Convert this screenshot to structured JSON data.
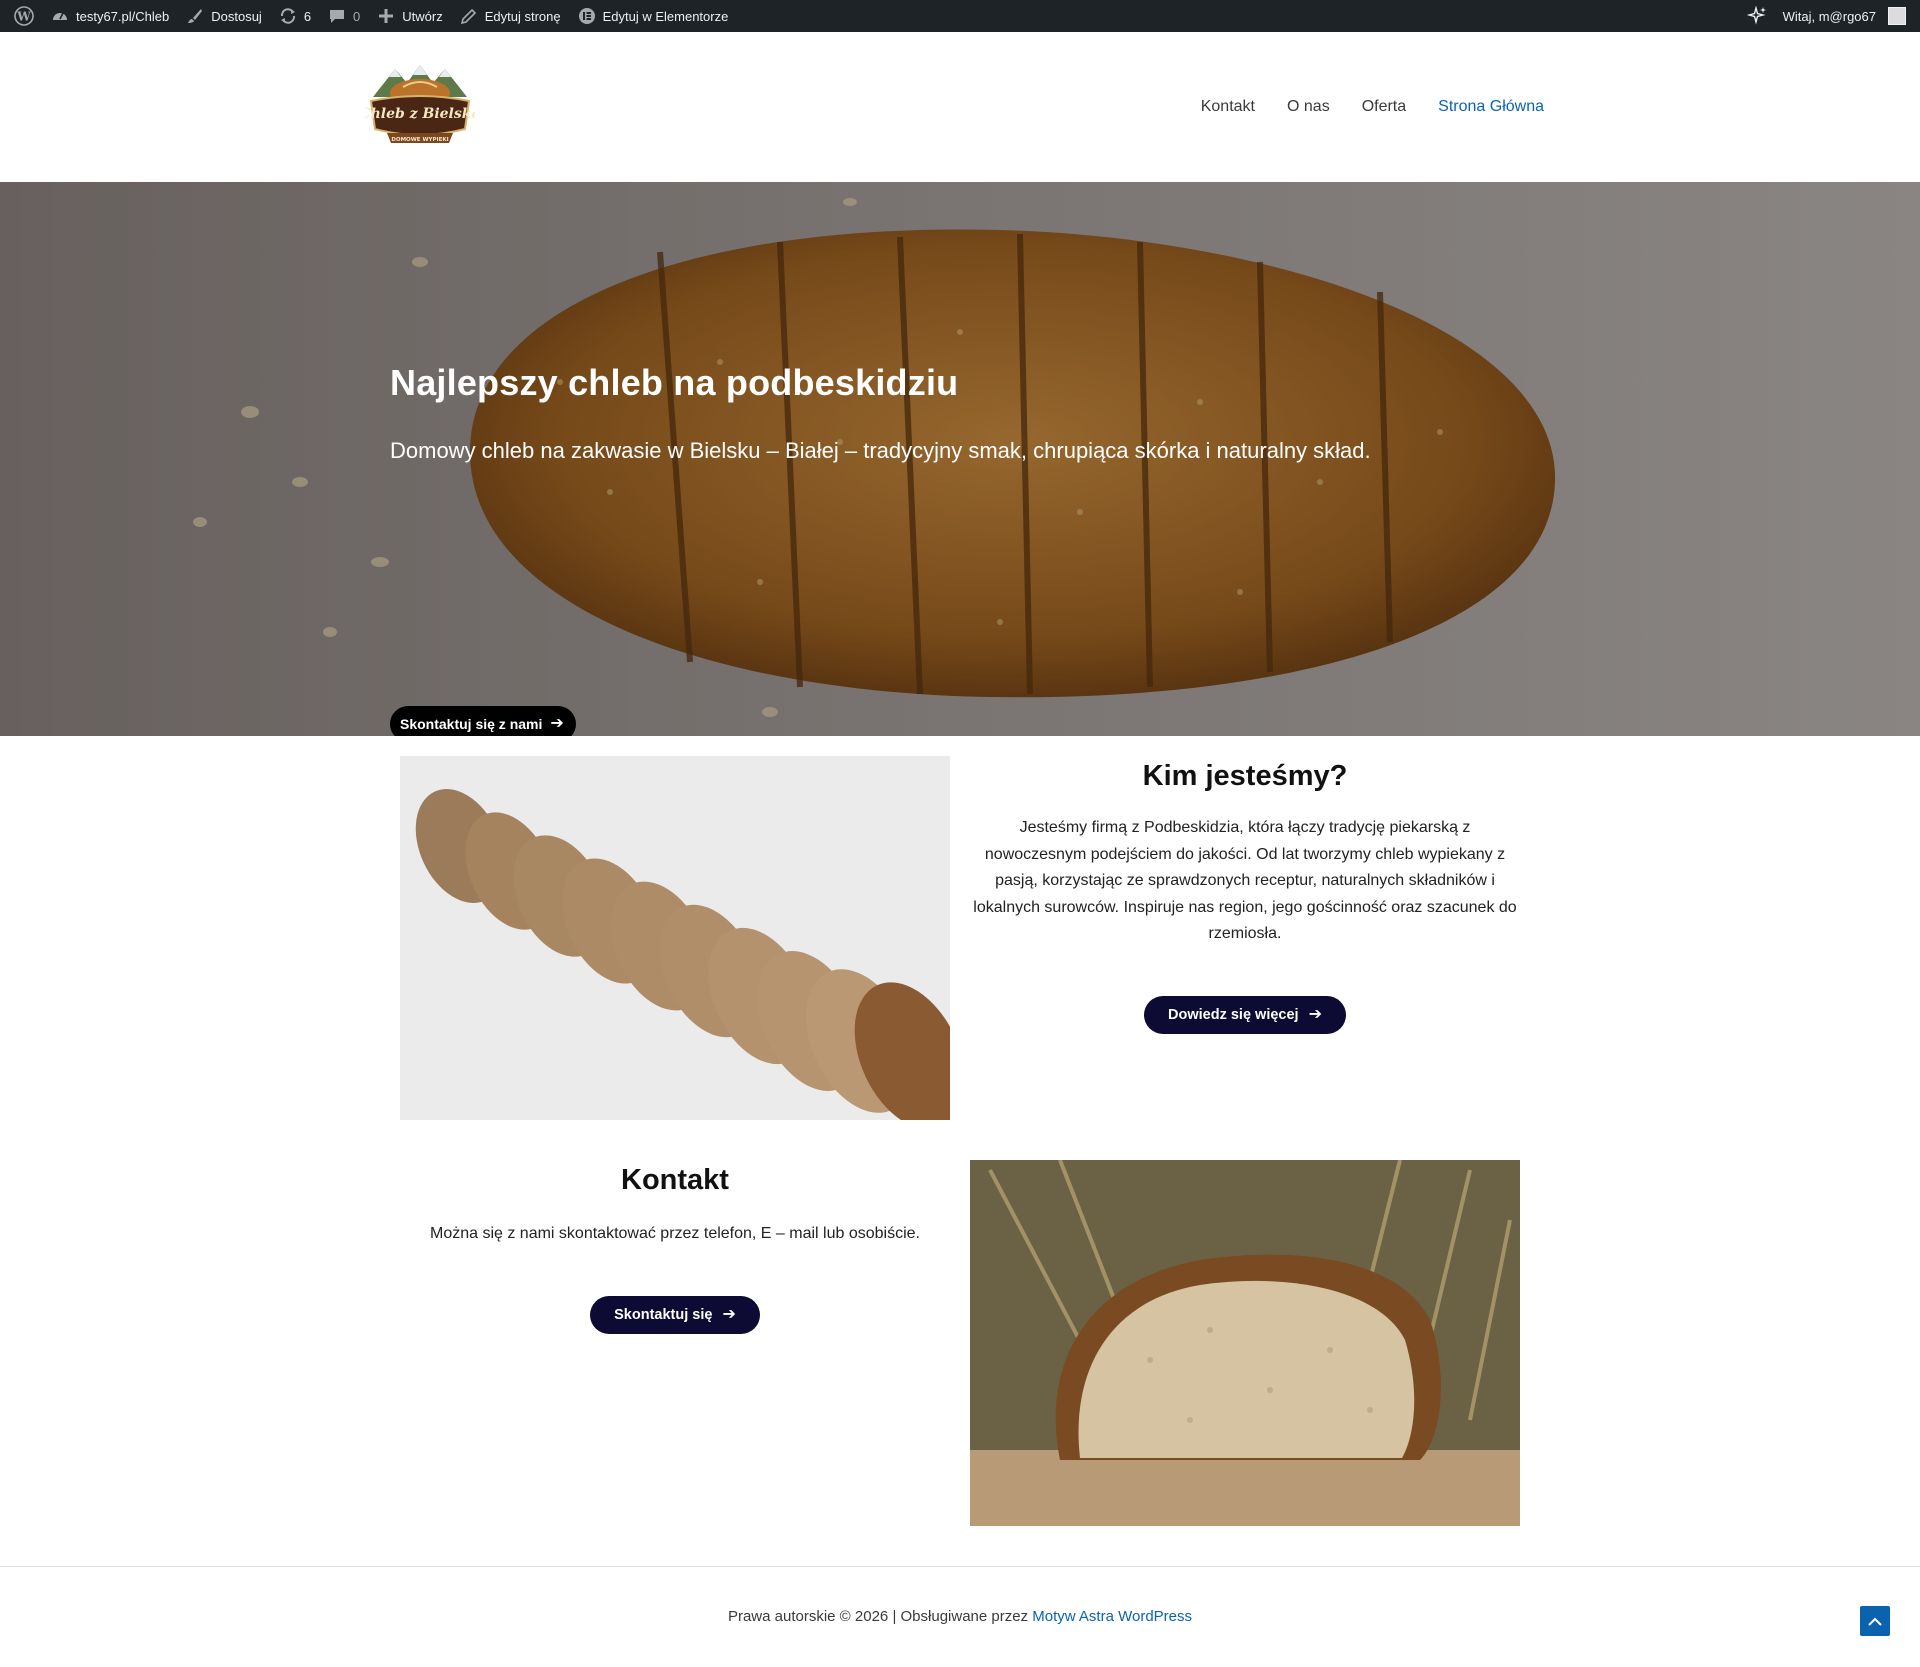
{
  "admin_bar": {
    "site_name": "testy67.pl/Chleb",
    "customize": "Dostosuj",
    "updates_count": "6",
    "comments_count": "0",
    "create": "Utwórz",
    "edit_page": "Edytuj stronę",
    "edit_elementor": "Edytuj w Elementorze",
    "greeting": "Witaj, m@rgo67"
  },
  "header": {
    "logo_text": "Chleb z Bielska",
    "logo_subtext": "DOMOWE WYPIEKI",
    "nav": [
      {
        "label": "Kontakt",
        "active": false
      },
      {
        "label": "O nas",
        "active": false
      },
      {
        "label": "Oferta",
        "active": false
      },
      {
        "label": "Strona Główna",
        "active": true
      }
    ]
  },
  "hero": {
    "title": "Najlepszy chleb na podbeskidziu",
    "subtitle": "Domowy chleb na zakwasie w Bielsku – Białej – tradycyjny smak, chrupiąca skórka i naturalny skład.",
    "button": "Skontaktuj się z nami"
  },
  "about": {
    "title": "Kim jesteśmy?",
    "text": "Jesteśmy firmą z Podbeskidzia, która łączy tradycję piekarską z nowoczesnym podejściem do jakości. Od lat tworzymy chleb wypiekany z pasją, korzystając ze sprawdzonych receptur, naturalnych składników i lokalnych surowców. Inspiruje nas region, jego gościnność oraz szacunek do rzemiosła.",
    "button": "Dowiedz się więcej"
  },
  "contact": {
    "title": "Kontakt",
    "text": "Można się z nami skontaktować przez telefon, E – mail lub osobiście.",
    "button": "Skontaktuj się"
  },
  "footer": {
    "text": "Prawa autorskie © 2026 | Obsługiwane przez ",
    "link": "Motyw Astra WordPress"
  },
  "colors": {
    "admin_bar": "#1d2327",
    "accent": "#0b63b0",
    "button_navy": "#0d0a33",
    "button_black": "#000000"
  }
}
